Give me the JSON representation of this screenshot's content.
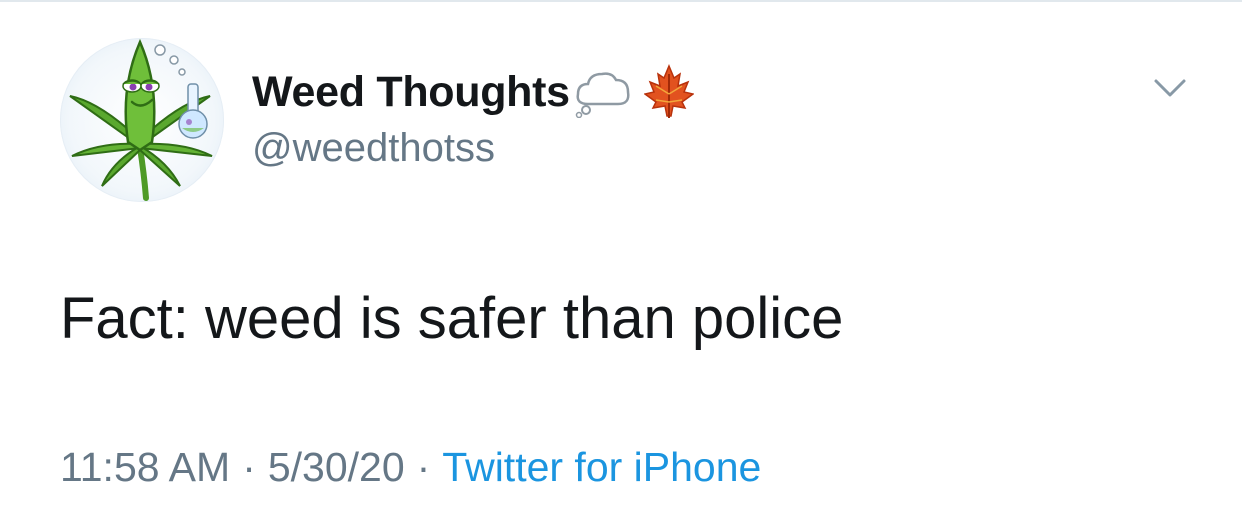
{
  "tweet": {
    "author": {
      "display_name": "Weed Thoughts",
      "name_emojis": [
        "thought-balloon-icon",
        "maple-leaf-icon"
      ],
      "handle": "@weedthotss",
      "avatar": "cannabis-leaf-cartoon-avatar"
    },
    "text": "Fact: weed is safer than police",
    "meta": {
      "time": "11:58 AM",
      "separator": "·",
      "date": "5/30/20",
      "source": "Twitter for iPhone"
    },
    "menu_icon": "chevron-down-icon"
  },
  "colors": {
    "text_primary": "#14171a",
    "text_secondary": "#657786",
    "link": "#1b95e0",
    "divider": "#e1e8ed",
    "leaf_green": "#5aa82e"
  }
}
